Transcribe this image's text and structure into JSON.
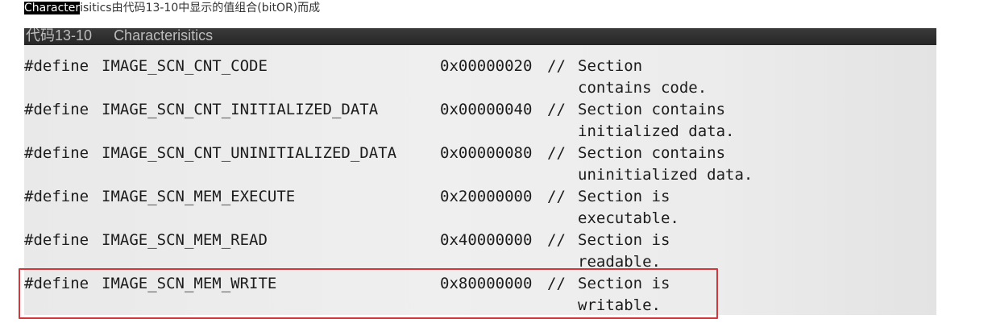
{
  "intro": {
    "highlighted": "Character",
    "rest": "isitics由代码13-10中显示的值组合(bitOR)而成"
  },
  "listing": {
    "header_number": "代码13-10",
    "header_title": "Characterisitics",
    "rows": [
      {
        "keyword": "#define",
        "name": "IMAGE_SCN_CNT_CODE",
        "value": "0x00000020",
        "comment": "//",
        "desc1": "Section",
        "desc2": "contains code."
      },
      {
        "keyword": "#define",
        "name": "IMAGE_SCN_CNT_INITIALIZED_DATA",
        "value": "0x00000040",
        "comment": "//",
        "desc1": "Section contains",
        "desc2": "initialized data."
      },
      {
        "keyword": "#define",
        "name": "IMAGE_SCN_CNT_UNINITIALIZED_DATA",
        "value": "0x00000080",
        "comment": "//",
        "desc1": "Section contains",
        "desc2": "uninitialized data."
      },
      {
        "keyword": "#define",
        "name": "IMAGE_SCN_MEM_EXECUTE",
        "value": "0x20000000",
        "comment": "//",
        "desc1": "Section is",
        "desc2": "executable."
      },
      {
        "keyword": "#define",
        "name": "IMAGE_SCN_MEM_READ",
        "value": "0x40000000",
        "comment": "//",
        "desc1": "Section is",
        "desc2": "readable."
      },
      {
        "keyword": "#define",
        "name": "IMAGE_SCN_MEM_WRITE",
        "value": "0x80000000",
        "comment": "//",
        "desc1": "Section is",
        "desc2": "writable."
      }
    ]
  },
  "highlight": {
    "color": "#d4373b"
  }
}
